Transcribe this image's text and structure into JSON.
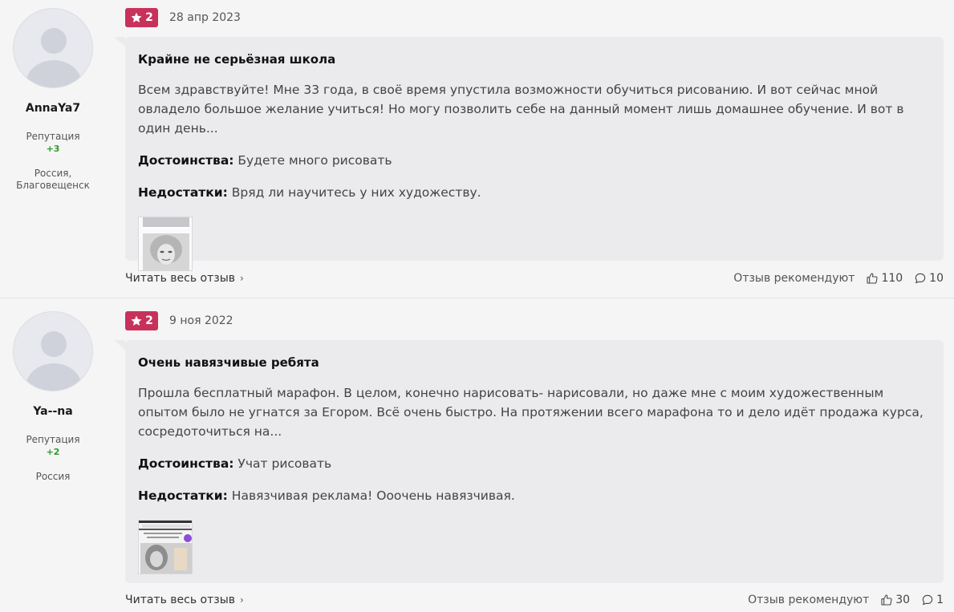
{
  "reviews": [
    {
      "author": {
        "name": "AnnaYa7",
        "rep_label": "Репутация",
        "rep_value": "+3",
        "location": "Россия, Благовещенск"
      },
      "rating": "2",
      "date": "28 апр 2023",
      "title": "Крайне не серьёзная школа",
      "text": "Всем здравствуйте! Мне 33 года, в своё время упустила возможности обучиться рисованию. И вот сейчас мной овладело большое желание учиться! Но могу позволить себе на данный момент лишь домашнее обучение. И вот в один день...",
      "pros_label": "Достоинства:",
      "pros": "Будете много рисовать",
      "cons_label": "Недостатки:",
      "cons": "Вряд ли научитесь у них художеству.",
      "read_more": "Читать весь отзыв",
      "recommend_label": "Отзыв рекомендуют",
      "likes": "110",
      "comments": "10"
    },
    {
      "author": {
        "name": "Ya--na",
        "rep_label": "Репутация",
        "rep_value": "+2",
        "location": "Россия"
      },
      "rating": "2",
      "date": "9 ноя 2022",
      "title": "Очень навязчивые ребята",
      "text": "Прошла бесплатный марафон. В целом, конечно нарисовать- нарисовали, но даже мне с моим художественным опытом было не угнатся за Егором. Всё очень быстро. На протяжении всего марафона то и дело идёт продажа курса, сосредоточиться на...",
      "pros_label": "Достоинства:",
      "pros": "Учат рисовать",
      "cons_label": "Недостатки:",
      "cons": "Навязчивая реклама! Ооочень навязчивая.",
      "read_more": "Читать весь отзыв",
      "recommend_label": "Отзыв рекомендуют",
      "likes": "30",
      "comments": "1"
    }
  ],
  "icons": {
    "rating": "star-icon",
    "like": "thumbs-up-icon",
    "comment": "comment-icon",
    "read_more": "chevron-right-icon"
  },
  "colors": {
    "rating_badge": "#c8325a",
    "reputation_positive": "#2a9d2a",
    "card_bg": "#ebebee"
  }
}
